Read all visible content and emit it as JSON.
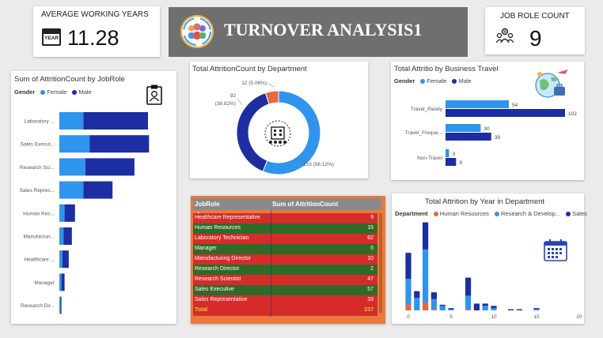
{
  "kpi_years": {
    "label": "AVERAGE WORKING YEARS",
    "value": "11.28",
    "icon": "calendar-year-icon",
    "icon_text": "YEAR"
  },
  "banner": {
    "title": "TURNOVER ANALYSIS1",
    "icon": "team-icon"
  },
  "kpi_roles": {
    "label": "JOB ROLE COUNT",
    "value": "9",
    "icon": "people-check-icon"
  },
  "colors": {
    "female": "#2f94ec",
    "male": "#1c2ea2",
    "hr": "#e8673c",
    "rd": "#2f94ec",
    "sales": "#1c2ea2",
    "header": "#8a8a8a",
    "red_row": "#d62b2b",
    "green_row": "#2f6a26",
    "total": "#d6d21e",
    "accent": "#e97a3c"
  },
  "chart_data": [
    {
      "type": "bar",
      "title": "Sum of AttritionCount by JobRole",
      "legend_title": "Gender",
      "categories": [
        "Laboratory ...",
        "Sales Execut...",
        "Research Sci...",
        "Sales Repres...",
        "Human Res...",
        "Manufacturi...",
        "Healthcare ...",
        "Manager",
        "Research Dir..."
      ],
      "series": [
        {
          "name": "Female",
          "values": [
            23,
            29,
            25,
            23,
            5,
            4,
            3,
            2,
            1
          ]
        },
        {
          "name": "Male",
          "values": [
            62,
            57,
            47,
            28,
            10,
            8,
            6,
            3,
            1
          ]
        }
      ]
    },
    {
      "type": "pie",
      "title": "Total AttritionCount by Department",
      "labels": [
        "Research & Development",
        "Sales",
        "Human Resources"
      ],
      "values": [
        133,
        92,
        12
      ],
      "slice_labels": [
        "133 (56.12%)",
        "92",
        "(38.82%)",
        "12 (5.06%)"
      ]
    },
    {
      "type": "bar",
      "title": "Total Attritio by Business Travel",
      "legend_title": "Gender",
      "categories": [
        "Travel_Rarely",
        "Travel_Freque...",
        "Non-Travel"
      ],
      "series": [
        {
          "name": "Female",
          "values": [
            54,
            30,
            3
          ]
        },
        {
          "name": "Male",
          "values": [
            102,
            39,
            9
          ]
        }
      ]
    },
    {
      "type": "bar",
      "title": "Total Attrition by Year in Department",
      "legend_title": "Department",
      "x": [
        0,
        1,
        2,
        3,
        4,
        5,
        6,
        7,
        8,
        9,
        10,
        11,
        12,
        13,
        14,
        15
      ],
      "xticks": [
        "0",
        "5",
        "10",
        "15",
        "20"
      ],
      "xlim": [
        0,
        20
      ],
      "series": [
        {
          "name": "Human Resources",
          "values": [
            5,
            0,
            7,
            1,
            0,
            0,
            0,
            1,
            0,
            0,
            0,
            0,
            0,
            0,
            0,
            0
          ]
        },
        {
          "name": "Research & Develop...",
          "values": [
            23,
            11,
            47,
            9,
            4,
            1,
            0,
            12,
            0,
            4,
            2,
            0,
            0,
            0,
            0,
            1
          ]
        },
        {
          "name": "Sales",
          "values": [
            23,
            6,
            24,
            6,
            1,
            1,
            0,
            16,
            6,
            2,
            2,
            0,
            1,
            1,
            0,
            1
          ]
        }
      ]
    },
    {
      "type": "table",
      "columns": [
        "JobRole",
        "Sum of AttritionCount"
      ],
      "rows": [
        [
          "Healthcare Representative",
          "9"
        ],
        [
          "Human Resources",
          "15"
        ],
        [
          "Laboratory Technician",
          "62"
        ],
        [
          "Manager",
          "5"
        ],
        [
          "Manufacturing Director",
          "10"
        ],
        [
          "Research Director",
          "2"
        ],
        [
          "Research Scientist",
          "47"
        ],
        [
          "Sales Executive",
          "57"
        ],
        [
          "Sales Representative",
          "33"
        ]
      ],
      "total": [
        "Total",
        "237"
      ]
    }
  ]
}
